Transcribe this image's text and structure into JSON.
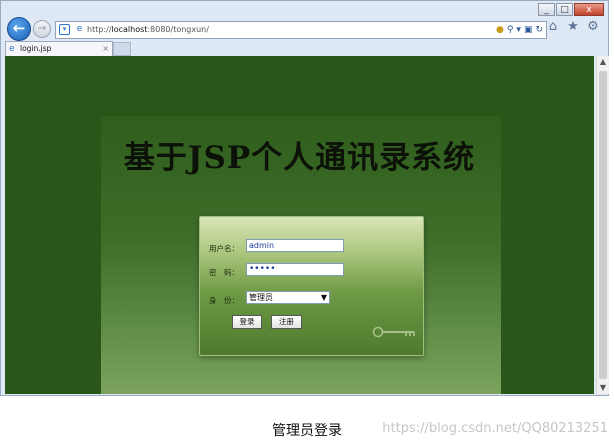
{
  "browser": {
    "url_prefix": "http://",
    "url_host": "localhost",
    "url_rest": ":8080/tongxun/",
    "window_buttons": {
      "min": "_",
      "max": "□",
      "close": "x"
    },
    "tab": {
      "label": "login.jsp",
      "close": "×"
    }
  },
  "page": {
    "title": "基于JSP个人通讯录系统",
    "form": {
      "username_label": "用户名：",
      "username_value": "admin",
      "password_label": "密　码：",
      "password_value": "•••••",
      "role_label": "身　份：",
      "role_selected": "管理员",
      "login_button": "登录",
      "register_button": "注册"
    }
  },
  "caption": "管理员登录",
  "watermark": "https://blog.csdn.net/QQ80213251",
  "icons": [
    "back-arrow-icon",
    "forward-arrow-icon",
    "search-icon",
    "refresh-icon",
    "home-icon",
    "star-icon",
    "gear-icon",
    "page-icon",
    "key-icon"
  ]
}
